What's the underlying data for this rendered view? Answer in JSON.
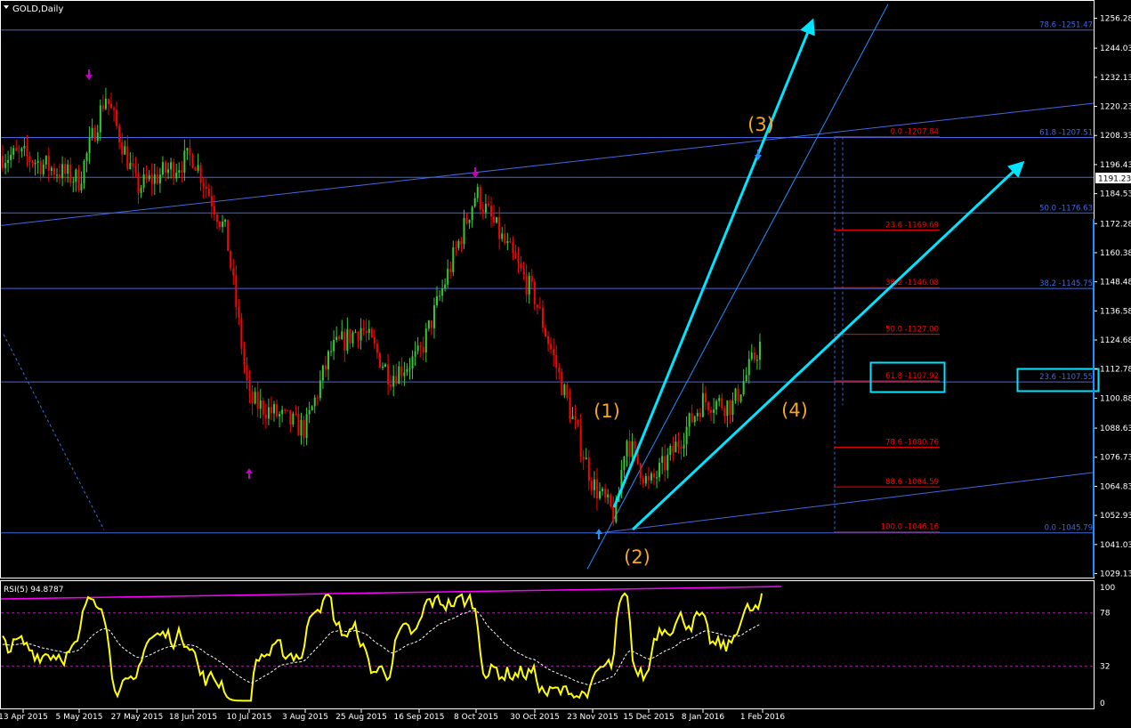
{
  "chart_title": "GOLD,Daily",
  "current_price": "1191.23",
  "colors": {
    "background": "#000000",
    "axis": "#ffffff",
    "candle_up": "#32cd32",
    "candle_down": "#ff0000",
    "hline": "#4169e1",
    "fib_red": "#ff0000",
    "fib_blue": "#4169e1",
    "cyan": "#00e5ff",
    "wave_label": "#f5a623",
    "fractal": "#c000c0",
    "rsi": "#ffff00",
    "rsi_ma": "#ffffff",
    "rsi_top": "#ff00ff"
  },
  "chart_data": [
    {
      "type": "candlestick",
      "title": "GOLD,Daily",
      "ylim": [
        1029.13,
        1262.13
      ],
      "price_axis_ticks": [
        "1256.28",
        "1244.03",
        "1232.13",
        "1220.23",
        "1208.33",
        "1196.43",
        "1184.53",
        "1172.28",
        "1160.38",
        "1148.48",
        "1136.58",
        "1124.68",
        "1112.78",
        "1100.88",
        "1088.63",
        "1076.73",
        "1064.83",
        "1052.93",
        "1041.03",
        "1029.13"
      ],
      "date_axis_ticks": [
        "13 Apr 2015",
        "5 May 2015",
        "27 May 2015",
        "18 Jun 2015",
        "10 Jul 2015",
        "3 Aug 2015",
        "25 Aug 2015",
        "16 Sep 2015",
        "8 Oct 2015",
        "30 Oct 2015",
        "23 Nov 2015",
        "15 Dec 2015",
        "8 Jan 2016",
        "1 Feb 2016"
      ],
      "horizontal_levels": [
        1251.47,
        1207.51,
        1191.23,
        1176.63,
        1145.75,
        1107.55,
        1045.79
      ],
      "price_path": [
        {
          "date": "13 Apr 2015",
          "price": 1200
        },
        {
          "date": "5 May 2015",
          "price": 1190
        },
        {
          "date": "15 May 2015",
          "price": 1225
        },
        {
          "date": "27 May 2015",
          "price": 1187
        },
        {
          "date": "18 Jun 2015",
          "price": 1200
        },
        {
          "date": "1 Jul 2015",
          "price": 1168
        },
        {
          "date": "10 Jul 2015",
          "price": 1100
        },
        {
          "date": "3 Aug 2015",
          "price": 1088
        },
        {
          "date": "13 Aug 2015",
          "price": 1120
        },
        {
          "date": "25 Aug 2015",
          "price": 1130
        },
        {
          "date": "5 Sep 2015",
          "price": 1110
        },
        {
          "date": "16 Sep 2015",
          "price": 1118
        },
        {
          "date": "8 Oct 2015",
          "price": 1185
        },
        {
          "date": "30 Oct 2015",
          "price": 1142
        },
        {
          "date": "23 Nov 2015",
          "price": 1066
        },
        {
          "date": "2 Dec 2015",
          "price": 1052
        },
        {
          "date": "6 Dec 2015",
          "price": 1085
        },
        {
          "date": "15 Dec 2015",
          "price": 1065
        },
        {
          "date": "23 Dec 2015",
          "price": 1075
        },
        {
          "date": "8 Jan 2016",
          "price": 1100
        },
        {
          "date": "20 Jan 2016",
          "price": 1098
        },
        {
          "date": "1 Feb 2016",
          "price": 1125
        },
        {
          "date": "10 Feb 2016",
          "price": 1195
        }
      ],
      "fib_retracement_red": [
        {
          "label": "0.0 -1207.84",
          "price": 1207.84
        },
        {
          "label": "23.6 -1169.69",
          "price": 1169.69
        },
        {
          "label": "38.2 -1146.08",
          "price": 1146.08
        },
        {
          "label": "50.0 -1127.00",
          "price": 1127.0
        },
        {
          "label": "61.8 -1107.92",
          "price": 1107.92
        },
        {
          "label": "78.6 -1080.76",
          "price": 1080.76
        },
        {
          "label": "88.6 -1064.59",
          "price": 1064.59
        },
        {
          "label": "100.0 -1046.16",
          "price": 1046.16
        }
      ],
      "fib_levels_blue": [
        {
          "label": "78.6 -1251.47",
          "price": 1251.47
        },
        {
          "label": "61.8 -1207.51",
          "price": 1207.51
        },
        {
          "label": "50.0 -1176.63",
          "price": 1176.63
        },
        {
          "label": "38.2 -1145.75",
          "price": 1145.75
        },
        {
          "label": "23.6 -1107.55",
          "price": 1107.55
        },
        {
          "label": "0.0 -1045.79",
          "price": 1045.79
        }
      ],
      "wave_labels": [
        "(1)",
        "(2)",
        "(3)",
        "(4)"
      ]
    },
    {
      "type": "line",
      "title": "RSI(5) 94.8787",
      "ylim": [
        0,
        100
      ],
      "levels": [
        78,
        32
      ],
      "axis_ticks": [
        "100",
        "78",
        "32",
        "0"
      ],
      "last_value": 94.8787
    }
  ]
}
